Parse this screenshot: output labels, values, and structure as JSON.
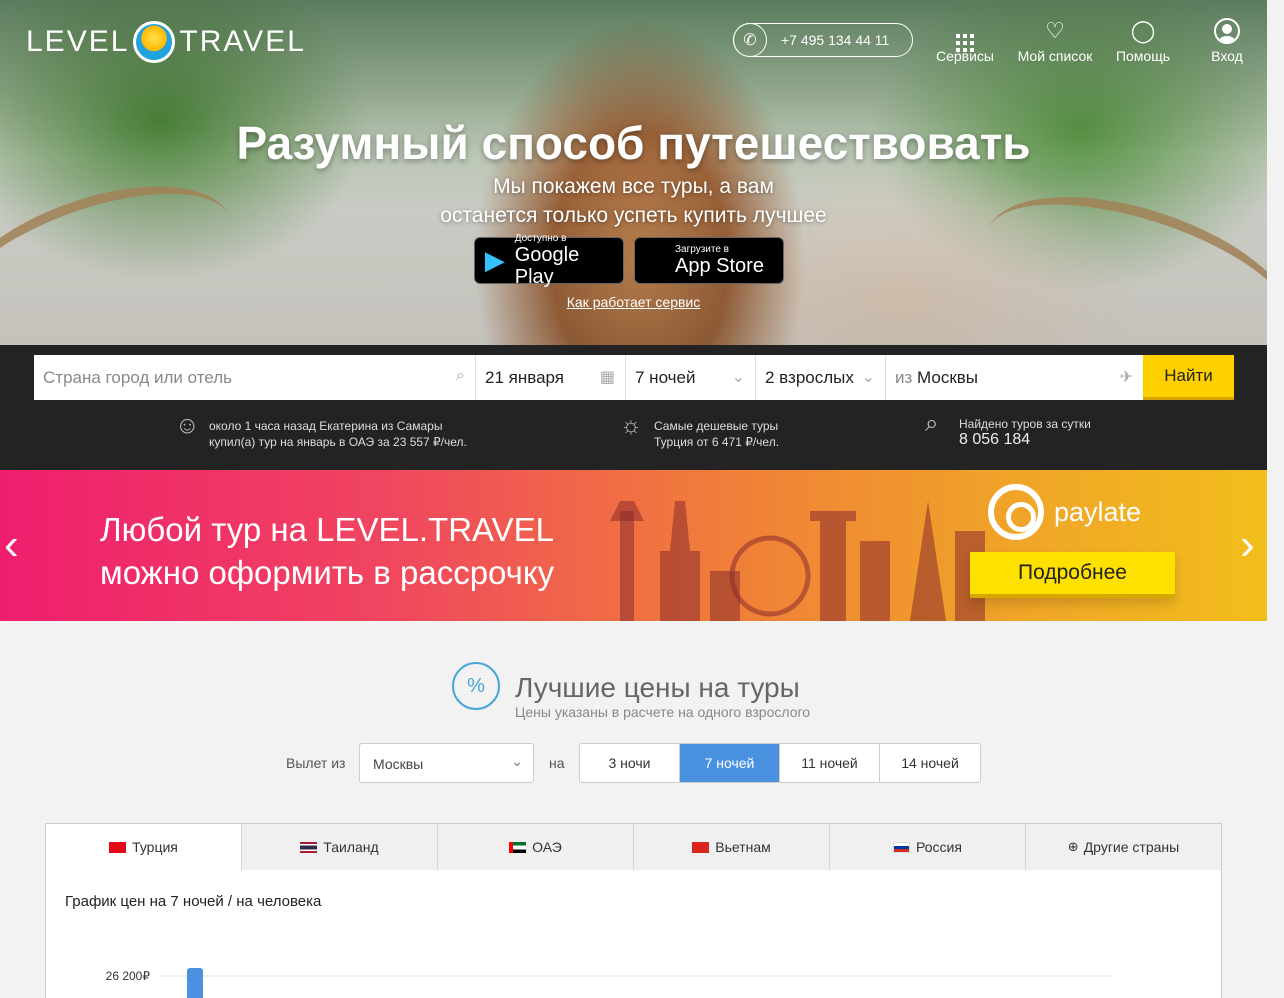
{
  "header": {
    "logo_left": "LEVEL",
    "logo_right": "TRAVEL",
    "phone": "+7 495 134 44 11",
    "nav": [
      {
        "label": "Сервисы",
        "icon": "grid-icon"
      },
      {
        "label": "Мой список",
        "icon": "heart-icon"
      },
      {
        "label": "Помощь",
        "icon": "bulb-icon"
      },
      {
        "label": "Вход",
        "icon": "user-icon"
      }
    ]
  },
  "hero": {
    "title": "Разумный способ путешествовать",
    "subtitle_line1": "Мы покажем все туры, а вам",
    "subtitle_line2": "останется только успеть купить лучшее",
    "google_small": "Доступно в",
    "google_big": "Google Play",
    "apple_small": "Загрузите в",
    "apple_big": "App Store",
    "how_link": "Как работает сервис"
  },
  "search": {
    "destination_placeholder": "Страна город или отель",
    "date": "21 января",
    "nights": "7 ночей",
    "guests": "2 взрослых",
    "from_prefix": "из",
    "from_city": "Москвы",
    "find_button": "Найти"
  },
  "info": {
    "recent_line1": "около 1 часа назад Екатерина из Самары",
    "recent_line2": "купил(а) тур на январь в ОАЭ за 23 557 ₽/чел.",
    "cheap_line1": "Самые дешевые туры",
    "cheap_line2": "Турция от 6 471 ₽/чел.",
    "found_line1": "Найдено туров за сутки",
    "found_count": "8 056 184"
  },
  "banner": {
    "line1": "Любой тур на LEVEL.TRAVEL",
    "line2": "можно оформить в рассрочку",
    "brand": "paylate",
    "more_button": "Подробнее",
    "prev": "‹",
    "next": "›"
  },
  "best_prices": {
    "title": "Лучшие цены на туры",
    "subtitle": "Цены указаны в расчете на одного взрослого",
    "departure_label": "Вылет из",
    "departure_value": "Москвы",
    "na_label": "на",
    "nights_options": [
      "3 ночи",
      "7 ночей",
      "11 ночей",
      "14 ночей"
    ],
    "nights_active": 1
  },
  "tabs": [
    {
      "label": "Турция",
      "colors": [
        "#e30a17",
        "#e30a17"
      ]
    },
    {
      "label": "Таиланд",
      "colors": [
        "#a51931",
        "#2d2a4a"
      ]
    },
    {
      "label": "ОАЭ",
      "colors": [
        "#00732f",
        "#000000"
      ]
    },
    {
      "label": "Вьетнам",
      "colors": [
        "#da251d",
        "#da251d"
      ]
    },
    {
      "label": "Россия",
      "colors": [
        "#ffffff",
        "#0039a6"
      ]
    },
    {
      "label": "Другие страны",
      "colors": []
    }
  ],
  "chart_data": {
    "type": "bar",
    "title": "График цен на 7 ночей / на человека",
    "ytick_labels": [
      "26 200₽"
    ],
    "ytick_values": [
      26200
    ],
    "series": [
      {
        "values": [
          26200
        ]
      }
    ],
    "bar_color": "#4a92e0"
  }
}
